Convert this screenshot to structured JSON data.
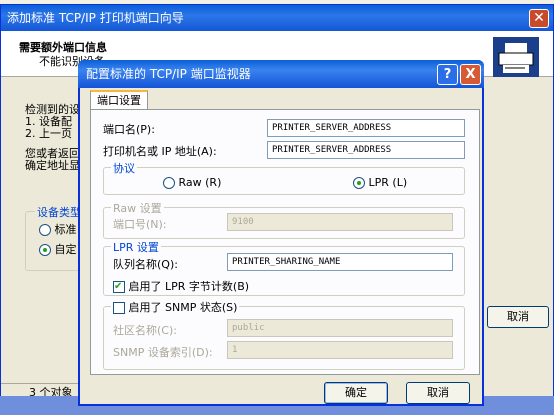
{
  "wizard": {
    "title": "添加标准 TCP/IP 打印机端口向导",
    "header_title": "需要额外端口信息",
    "header_subtitle": "不能识别设备。",
    "body_line1": "检测到的设",
    "body_line2": "1. 设备配",
    "body_line3": "2. 上一页",
    "body_line4": "您或者返回",
    "body_line5": "确定地址显",
    "device_type_group": "设备类型",
    "radio_standard": "标准",
    "radio_custom": "自定",
    "cancel_label": "取消",
    "status_objects": "3 个对象"
  },
  "dialog": {
    "title": "配置标准的 TCP/IP 端口监视器",
    "help_glyph": "?",
    "close_glyph": "X",
    "tab_label": "端口设置",
    "port_name_label": "端口名(P):",
    "port_name_value": "PRINTER_SERVER_ADDRESS",
    "printer_addr_label": "打印机名或 IP 地址(A):",
    "printer_addr_value": "PRINTER_SERVER_ADDRESS",
    "protocol_group": "协议",
    "raw_label": "Raw (R)",
    "lpr_label": "LPR (L)",
    "protocol_selected": "LPR",
    "raw_group": "Raw 设置",
    "port_number_label": "端口号(N):",
    "port_number_value": "9100",
    "lpr_group": "LPR 设置",
    "queue_name_label": "队列名称(Q):",
    "queue_name_value": "PRINTER_SHARING_NAME",
    "lpr_bytecount_label": "启用了 LPR 字节计数(B)",
    "lpr_bytecount_checked": true,
    "snmp_label": "启用了 SNMP 状态(S)",
    "snmp_checked": false,
    "community_label": "社区名称(C):",
    "community_value": "public",
    "snmp_index_label": "SNMP 设备索引(D):",
    "snmp_index_value": "1",
    "ok_label": "确定",
    "cancel_label": "取消"
  }
}
